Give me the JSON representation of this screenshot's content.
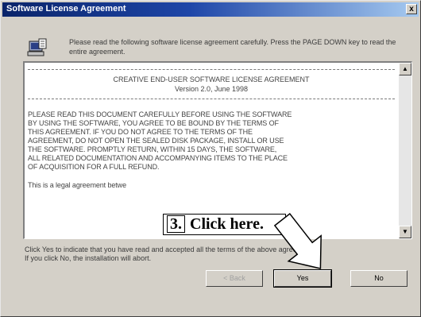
{
  "window": {
    "title": "Software License Agreement",
    "close_glyph": "x"
  },
  "header": {
    "icon": "setup-computer-icon",
    "text": "Please read the following software license agreement carefully. Press the PAGE DOWN key to read the entire agreement."
  },
  "license": {
    "title": "CREATIVE END-USER SOFTWARE LICENSE AGREEMENT",
    "version": "Version 2.0, June 1998",
    "body_lines": [
      "PLEASE READ THIS DOCUMENT CAREFULLY BEFORE USING THE SOFTWARE",
      "BY USING THE SOFTWARE, YOU AGREE TO BE BOUND BY THE TERMS OF",
      "THIS AGREEMENT.  IF YOU DO NOT AGREE TO THE TERMS OF THE",
      "AGREEMENT, DO NOT OPEN THE SEALED DISK PACKAGE, INSTALL OR USE",
      "THE SOFTWARE.  PROMPTLY RETURN, WITHIN 15 DAYS, THE SOFTWARE,",
      "ALL RELATED DOCUMENTATION AND ACCOMPANYING ITEMS TO THE PLACE",
      "OF ACQUISITION FOR A FULL REFUND."
    ],
    "last_line": "This is a legal agreement betwe",
    "scroll_up_glyph": "▲",
    "scroll_down_glyph": "▼"
  },
  "footer": {
    "line1": "Click Yes to indicate that you have read and accepted all the terms of the above agreement.",
    "line2": "If you click No, the installation will abort."
  },
  "buttons": {
    "back": "< Back",
    "yes": "Yes",
    "no": "No"
  },
  "callout": {
    "number": "3.",
    "text": "Click here."
  },
  "colors": {
    "title_gradient_start": "#0a246a",
    "title_gradient_end": "#a6caf0",
    "dialog_face": "#d4d0c8"
  }
}
